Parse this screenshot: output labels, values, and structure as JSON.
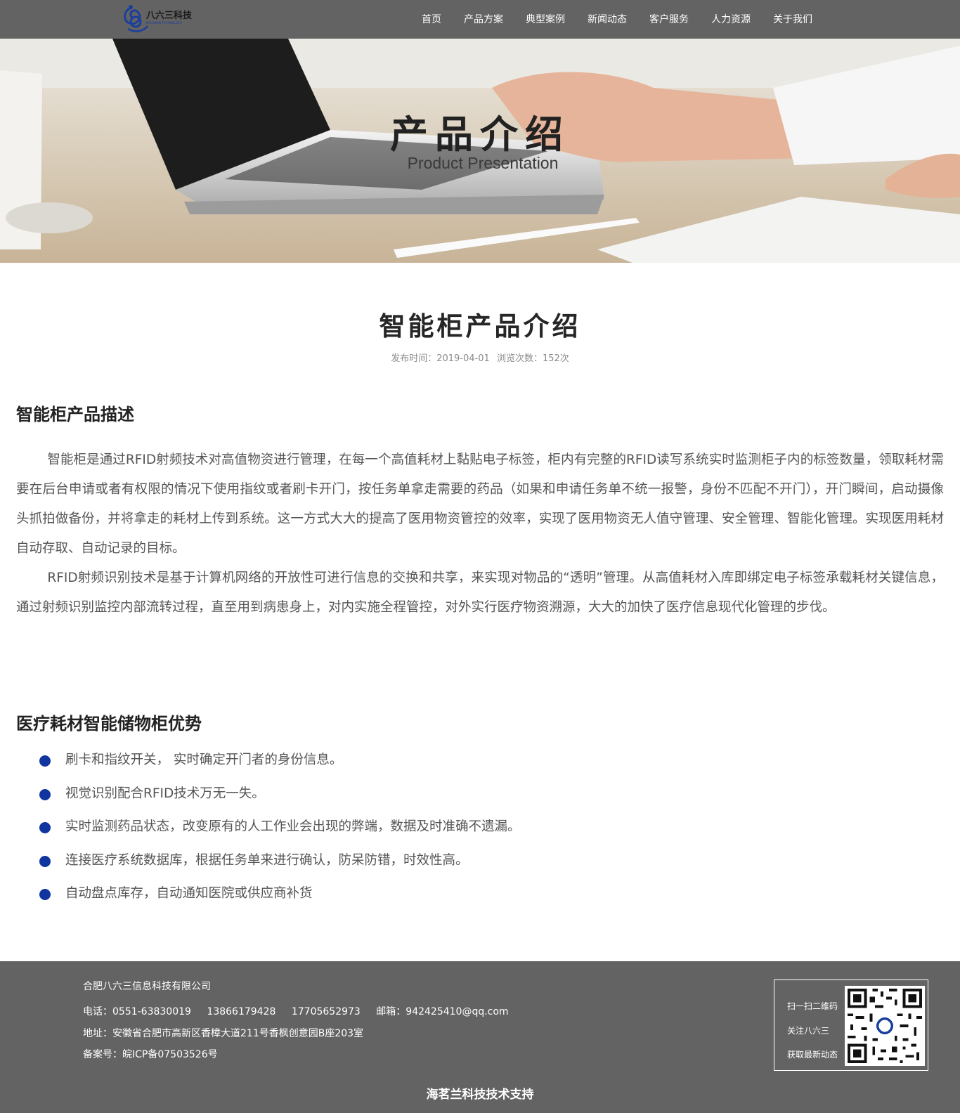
{
  "header": {
    "logo_text": "八六三科技",
    "logo_sub": "BALIUSAN TECHNOLOGY",
    "nav": [
      "首页",
      "产品方案",
      "典型案例",
      "新闻动态",
      "客户服务",
      "人力资源",
      "关于我们"
    ]
  },
  "banner": {
    "title": "产品介绍",
    "subtitle": "Product Presentation"
  },
  "article": {
    "title": "智能柜产品介绍",
    "meta": {
      "publish": "发布时间：2019-04-01",
      "views": "浏览次数：152次"
    },
    "section1": {
      "heading": "智能柜产品描述",
      "paragraphs": [
        "智能柜是通过RFID射频技术对高值物资进行管理，在每一个高值耗材上黏贴电子标签，柜内有完整的RFID读写系统实时监测柜子内的标签数量，领取耗材需要在后台申请或者有权限的情况下使用指纹或者刷卡开门，按任务单拿走需要的药品（如果和申请任务单不统一报警，身份不匹配不开门），开门瞬间，启动摄像头抓拍做备份，并将拿走的耗材上传到系统。这一方式大大的提高了医用物资管控的效率，实现了医用物资无人值守管理、安全管理、智能化管理。实现医用耗材自动存取、自动记录的目标。",
        "RFID射频识别技术是基于计算机网络的开放性可进行信息的交换和共享，来实现对物品的“透明”管理。从高值耗材入库即绑定电子标签承载耗材关键信息，通过射频识别监控内部流转过程，直至用到病患身上，对内实施全程管控，对外实行医疗物资溯源，大大的加快了医疗信息现代化管理的步伐。"
      ]
    },
    "section2": {
      "heading": "医疗耗材智能储物柜优势",
      "items": [
        "刷卡和指纹开关， 实时确定开门者的身份信息。",
        "视觉识别配合RFID技术万无一失。",
        "实时监测药品状态，改变原有的人工作业会出现的弊端，数据及时准确不遗漏。",
        "连接医疗系统数据库，根据任务单来进行确认，防呆防错，时效性高。",
        "自动盘点库存，自动通知医院或供应商补货"
      ]
    }
  },
  "footer": {
    "company": "合肥八六三信息科技有限公司",
    "phone": "电话：0551-63830019",
    "mobile1": "13866179428",
    "mobile2": "17705652973",
    "email": "邮箱：942425410@qq.com",
    "address": "地址：安徽省合肥市高新区香樟大道211号香枫创意园B座203室",
    "icp": "备案号：皖ICP备07503526号",
    "qr_lines": [
      "扫一扫二维码",
      "关注八六三",
      "获取最新动态"
    ],
    "credit": "海茗兰科技技术支持"
  },
  "colors": {
    "header_bg": "#636363",
    "footer_bg": "#636363",
    "bullet": "#11359f",
    "logo_blue": "#1b3f9c"
  }
}
